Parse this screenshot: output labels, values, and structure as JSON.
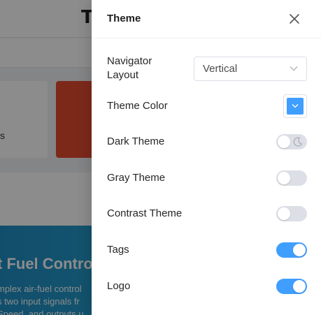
{
  "background": {
    "logo_text": "T",
    "card_text": "s",
    "banner_title": "t Fuel Control (",
    "banner_lines": [
      "mplex air-fuel control",
      "s two input signals fr",
      "Speed, and outputs u"
    ]
  },
  "drawer": {
    "title": "Theme",
    "close_icon": "close-icon",
    "settings": {
      "navigator_layout": {
        "label": "Navigator Layout",
        "value": "Vertical"
      },
      "theme_color": {
        "label": "Theme Color",
        "value": "#409eff"
      },
      "dark_theme": {
        "label": "Dark Theme",
        "enabled": false,
        "icon": "moon-icon"
      },
      "gray_theme": {
        "label": "Gray Theme",
        "enabled": false
      },
      "contrast_theme": {
        "label": "Contrast Theme",
        "enabled": false
      },
      "tags": {
        "label": "Tags",
        "enabled": true
      },
      "logo": {
        "label": "Logo",
        "enabled": true
      }
    }
  },
  "colors": {
    "accent": "#409eff",
    "switch_off": "#dcdfe6",
    "banner": "#2aa3cf",
    "red_card": "#e34b31"
  }
}
